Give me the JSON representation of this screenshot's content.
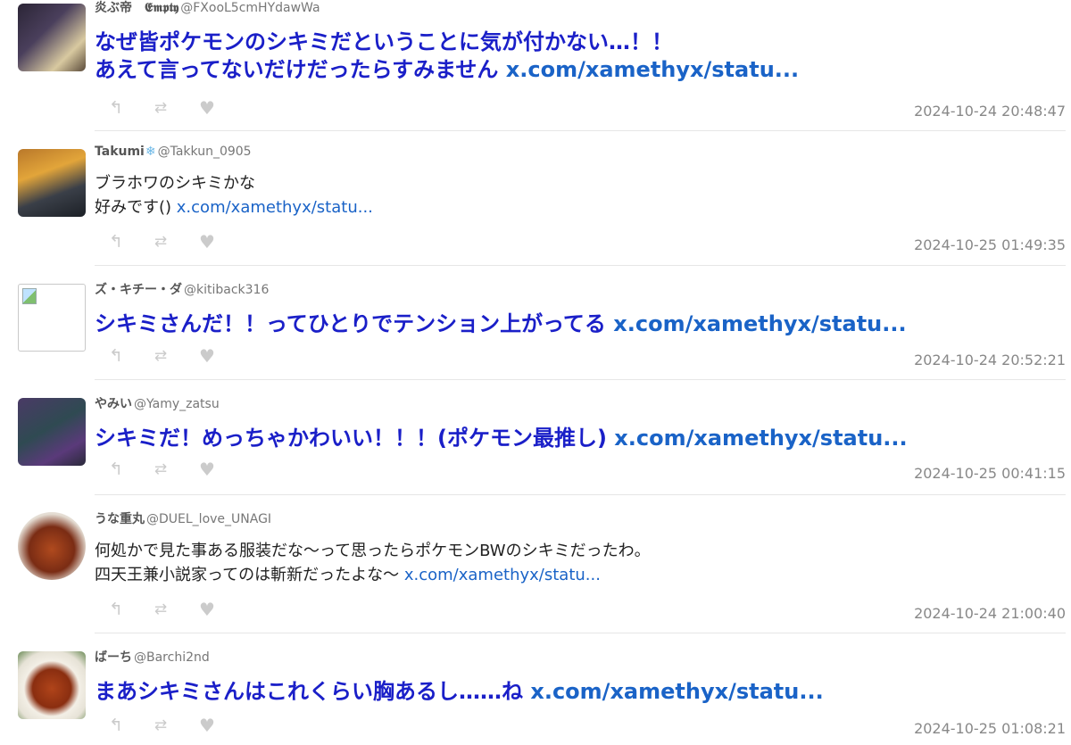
{
  "tweets": [
    {
      "user_name": "炎ぶ帝　𝕰𝖒𝖕𝖙𝖞",
      "handle": "@FXooL5cmHYdawWa",
      "text_lines": [
        "なぜ皆ポケモンのシキミだということに気が付かない…！！",
        "あえて言ってないだけだったらすみません"
      ],
      "link": "x.com/xamethyx/statu...",
      "timestamp": "2024-10-24 20:48:47"
    },
    {
      "user_name": "Takumi",
      "name_emoji": "❄",
      "handle": "@Takkun_0905",
      "text_lines": [
        "ブラホワのシキミかな",
        "好みです()"
      ],
      "link": "x.com/xamethyx/statu...",
      "timestamp": "2024-10-25 01:49:35"
    },
    {
      "user_name": "ズ・キチー・ダ",
      "handle": "@kitiback316",
      "text_lines": [
        "シキミさんだ！！ってひとりでテンション上がってる"
      ],
      "link": "x.com/xamethyx/statu...",
      "timestamp": "2024-10-24 20:52:21"
    },
    {
      "user_name": "やみい",
      "handle": "@Yamy_zatsu",
      "text_lines": [
        "シキミだ！めっちゃかわいい！！！(ポケモン最推し)"
      ],
      "link": "x.com/xamethyx/statu...",
      "timestamp": "2024-10-25 00:41:15"
    },
    {
      "user_name": "うな重丸",
      "handle": "@DUEL_love_UNAGI",
      "text_lines": [
        "何処かで見た事ある服装だな～って思ったらポケモンBWのシキミだったわ。",
        "四天王兼小説家ってのは斬新だったよな～"
      ],
      "link": "x.com/xamethyx/statu...",
      "timestamp": "2024-10-24 21:00:40"
    },
    {
      "user_name": "ばーち",
      "handle": "@Barchi2nd",
      "text_lines": [
        "まあシキミさんはこれくらい胸あるし……ね"
      ],
      "link": "x.com/xamethyx/statu...",
      "timestamp": "2024-10-25 01:08:21"
    }
  ],
  "icons": {
    "reply": "reply-icon",
    "retweet": "retweet-icon",
    "like": "heart-icon",
    "glyph_reply": "↰",
    "glyph_retweet": "⇄",
    "glyph_like": "♥"
  },
  "colors": {
    "big_text": "#1a1fc8",
    "link": "#1a63c7",
    "timestamp": "#888888",
    "action_icon": "#cbcbcb"
  }
}
